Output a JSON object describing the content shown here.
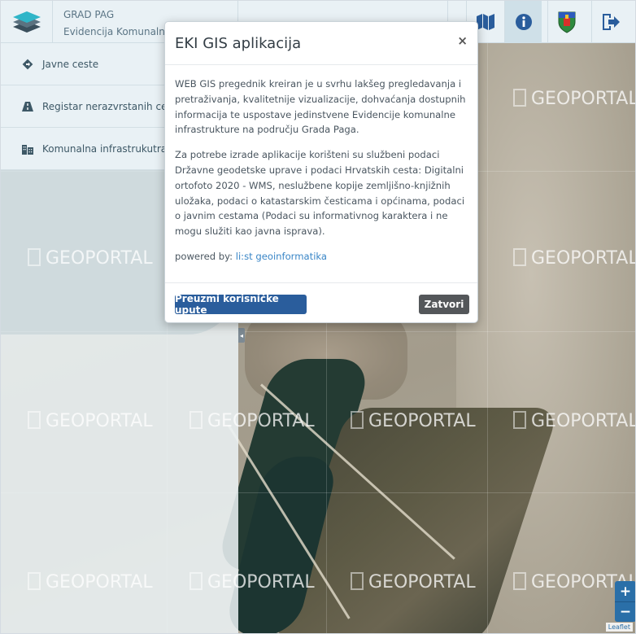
{
  "header": {
    "org_name": "GRAD PAG",
    "app_subtitle": "Evidencija Komunalne infrastrukture"
  },
  "toolbar": [
    {
      "name": "map-button",
      "icon": "map-icon"
    },
    {
      "name": "info-button",
      "icon": "info-icon",
      "active": true
    },
    {
      "name": "coat-of-arms-button",
      "icon": "coat-of-arms-icon"
    },
    {
      "name": "logout-button",
      "icon": "logout-icon"
    }
  ],
  "sidebar": {
    "items": [
      {
        "label": "Javne ceste",
        "icon": "diamond-direction-icon"
      },
      {
        "label": "Registar nerazvrstanih cesta",
        "icon": "road-icon"
      },
      {
        "label": "Komunalna infrastrukutra",
        "icon": "buildings-icon"
      }
    ]
  },
  "modal": {
    "title": "EKI GIS aplikacija",
    "close_label": "×",
    "paragraph1": "WEB GIS pregednik kreiran je u svrhu lakšeg pregledavanja i pretraživanja, kvalitetnije vizualizacije, dohvaćanja dostupnih informacija te uspostave jedinstvene Evidencije komunalne infrastrukture na području Grada Paga.",
    "paragraph2": "Za potrebe izrade aplikacije korišteni su službeni podaci Državne geodetske uprave i podaci Hrvatskih cesta: Digitalni ortofoto 2020 - WMS, neslužbene kopije zemljišno-knjižnih uložaka, podaci o katastarskim česticama i općinama, podaci o javnim cestama (Podaci su informativnog karaktera i ne mogu služiti kao javna isprava).",
    "powered_by_prefix": "powered by: ",
    "powered_by_link": "li:st geoinformatika",
    "download_button": "Preuzmi korisničke upute",
    "close_button": "Zatvori"
  },
  "map": {
    "watermark_text": "GEOPORTAL",
    "zoom_in": "+",
    "zoom_out": "−",
    "attribution": "Leaflet"
  },
  "colors": {
    "accent_blue": "#2a5d9c",
    "zoom_blue": "#2a6fa8",
    "dark_button": "#54575a",
    "panel_bg": "#e9f1f5"
  }
}
